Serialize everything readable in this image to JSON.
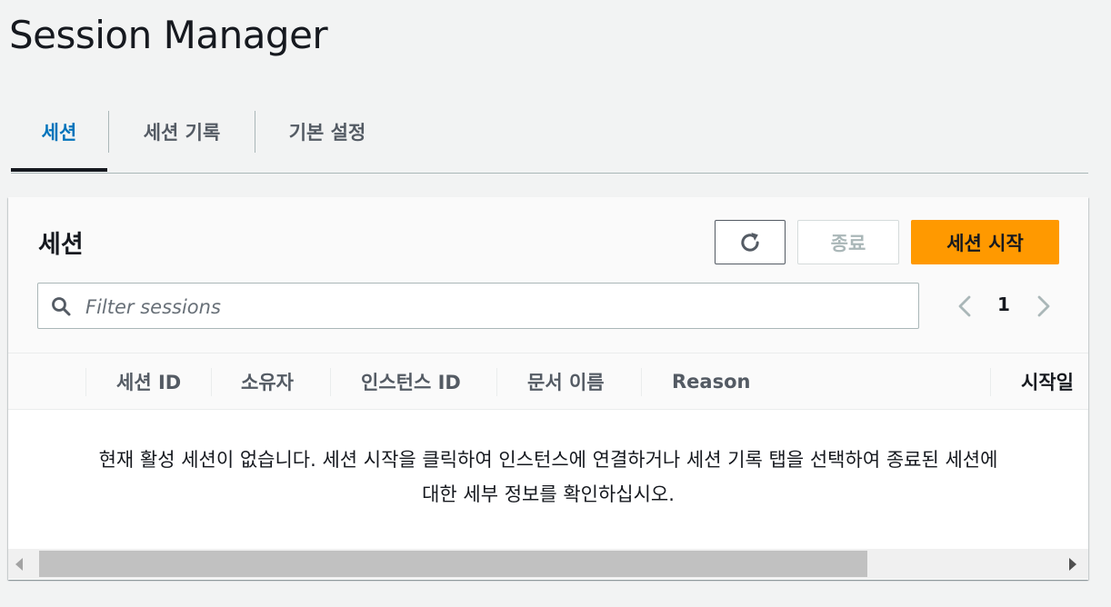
{
  "header": {
    "title": "Session Manager"
  },
  "tabs": [
    {
      "label": "세션",
      "active": true
    },
    {
      "label": "세션 기록",
      "active": false
    },
    {
      "label": "기본 설정",
      "active": false
    }
  ],
  "panel": {
    "title": "세션",
    "buttons": {
      "refresh_icon": "refresh-icon",
      "terminate_label": "종료",
      "start_label": "세션 시작"
    },
    "search": {
      "placeholder": "Filter sessions",
      "value": ""
    },
    "pagination": {
      "current_page": "1"
    },
    "columns": [
      "세션 ID",
      "소유자",
      "인스턴스 ID",
      "문서 이름",
      "Reason",
      "시작일"
    ],
    "empty_message_line1": "현재 활성 세션이 없습니다. 세션 시작을 클릭하여 인스턴스에 연결하거나 세션 기록 탭을 선택하여 종료된 세션에",
    "empty_message_line2": "대한 세부 정보를 확인하십시오."
  },
  "colors": {
    "accent": "#0073bb",
    "primary_button": "#ff9900",
    "background": "#f2f3f3"
  }
}
